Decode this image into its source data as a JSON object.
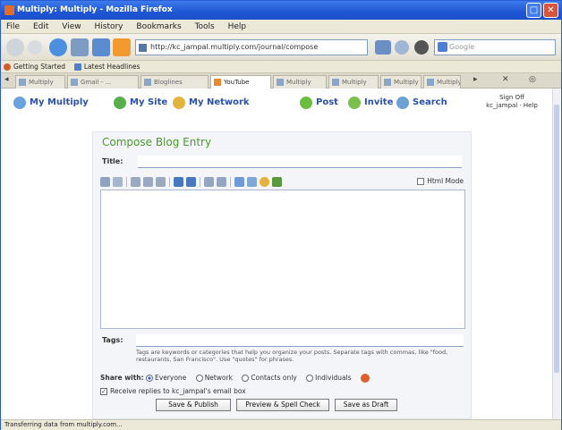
{
  "window": {
    "title": "Multiply: Multiply - Mozilla Firefox"
  },
  "menu": [
    "File",
    "Edit",
    "View",
    "History",
    "Bookmarks",
    "Tools",
    "Help"
  ],
  "navbar": {
    "url": "http://kc_jampal.multiply.com/journal/compose",
    "search_placeholder": "Google"
  },
  "bookmarks": [
    "Getting Started",
    "Latest Headlines"
  ],
  "tabs": [
    "Multiply",
    "Gmail - ...",
    "Bloglines",
    "YouTube",
    "Multiply",
    "Multiply",
    "Multiply",
    "Multiply"
  ],
  "site_nav": {
    "my_multiply": "My Multiply",
    "my_site": "My Site",
    "my_network": "My Network",
    "post": "Post",
    "invite": "Invite",
    "search": "Search"
  },
  "user": {
    "line1": "Sign Off",
    "line2": "kc_jampal · Help"
  },
  "compose": {
    "heading": "Compose Blog Entry",
    "title_label": "Title:",
    "title_value": "",
    "html_mode_label": "Html Mode",
    "tags_label": "Tags:",
    "tags_value": "",
    "tags_help": "Tags are keywords or categories that help you organize your posts. Separate tags with commas, like \"food, restaurants, San Francisco\". Use \"quotes\" for phrases.",
    "share_label": "Share with:",
    "share_options": [
      "Everyone",
      "Network",
      "Contacts only",
      "Individuals"
    ],
    "share_selected": 0,
    "email_label": "Receive replies to kc_jampal's email box",
    "email_checked": true,
    "buttons": {
      "publish": "Save & Publish",
      "preview": "Preview & Spell Check",
      "draft": "Save as Draft"
    }
  },
  "status": "Transferring data from multiply.com..."
}
